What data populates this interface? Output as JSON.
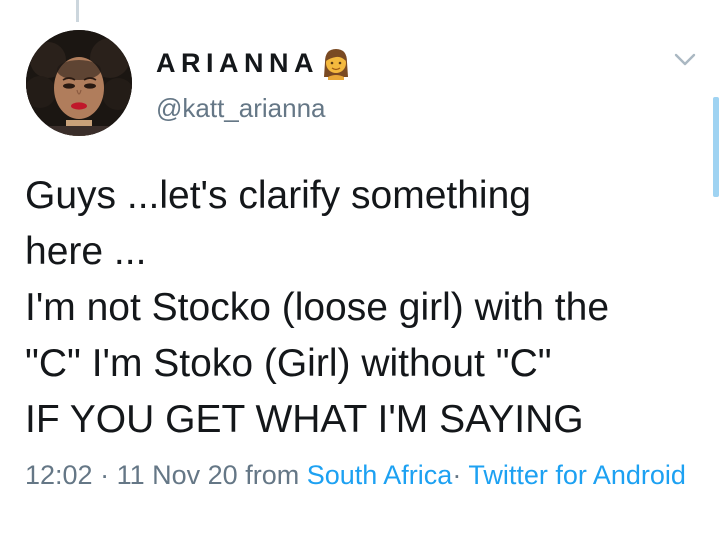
{
  "tweet": {
    "display_name": "ARIANNA",
    "name_emoji_icon": "woman-emoji-icon",
    "handle": "@katt_arianna",
    "menu_icon": "chevron-down-icon",
    "text_lines": [
      "Guys ...let's clarify something",
      "here ...",
      "I'm not Stocko (loose girl) with the",
      "\"C\" I'm Stoko (Girl) without \"C\"",
      "IF YOU GET WHAT I'M SAYING"
    ],
    "time": "12:02",
    "separator": "·",
    "date": "11 Nov 20",
    "from_label": "from",
    "location": "South Africa",
    "source": "Twitter for Android"
  },
  "colors": {
    "text": "#14171a",
    "secondary": "#657786",
    "link": "#1da1f2",
    "scrollbar": "#9fd3f2"
  }
}
